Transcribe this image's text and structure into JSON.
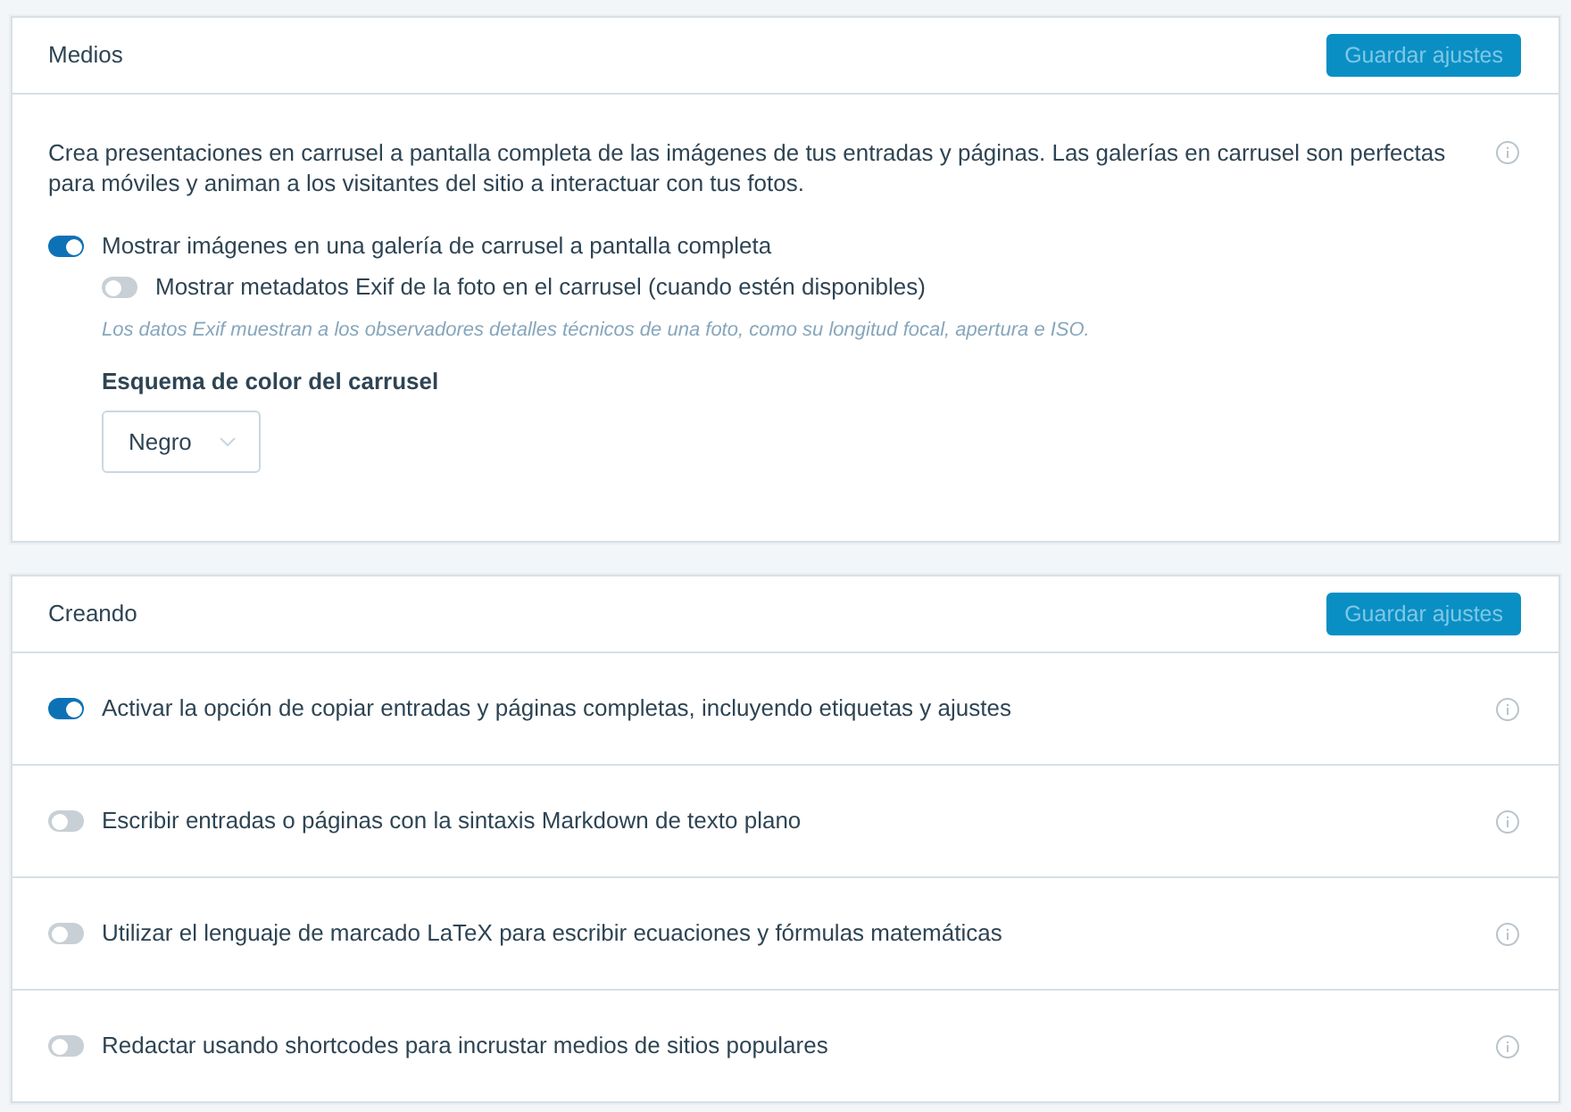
{
  "sections": [
    {
      "title": "Medios",
      "button": {
        "label": "Guardar ajustes",
        "disabled": true
      },
      "rows": [
        {
          "kind": "group",
          "description": "Crea presentaciones en carrusel a pantalla completa de las imágenes de tus entradas y páginas. Las galerías en carrusel son perfectas para móviles y animan a los visitantes del sitio a interactuar con tus fotos.",
          "toggles": [
            {
              "label": "Mostrar imágenes en una galería de carrusel a pantalla completa",
              "on": true,
              "children": [
                {
                  "label": "Mostrar metadatos Exif de la foto en el carrusel (cuando estén disponibles)",
                  "on": false
                }
              ]
            }
          ],
          "note": "Los datos Exif muestran a los observadores detalles técnicos de una foto, como su longitud focal, apertura e ISO.",
          "select": {
            "label": "Esquema de color del carrusel",
            "value": "Negro"
          }
        }
      ]
    },
    {
      "title": "Creando",
      "button": {
        "label": "Guardar ajustes",
        "disabled": true
      },
      "rows": [
        {
          "kind": "toggle",
          "label": "Activar la opción de copiar entradas y páginas completas, incluyendo etiquetas y ajustes",
          "on": true
        },
        {
          "kind": "toggle",
          "label": "Escribir entradas o páginas con la sintaxis Markdown de texto plano",
          "on": false
        },
        {
          "kind": "toggle",
          "label": "Utilizar el lenguaje de marcado LaTeX para escribir ecuaciones y fórmulas matemáticas",
          "on": false
        },
        {
          "kind": "toggle",
          "label": "Redactar usando shortcodes para incrustar medios de sitios populares",
          "on": false
        }
      ]
    }
  ]
}
